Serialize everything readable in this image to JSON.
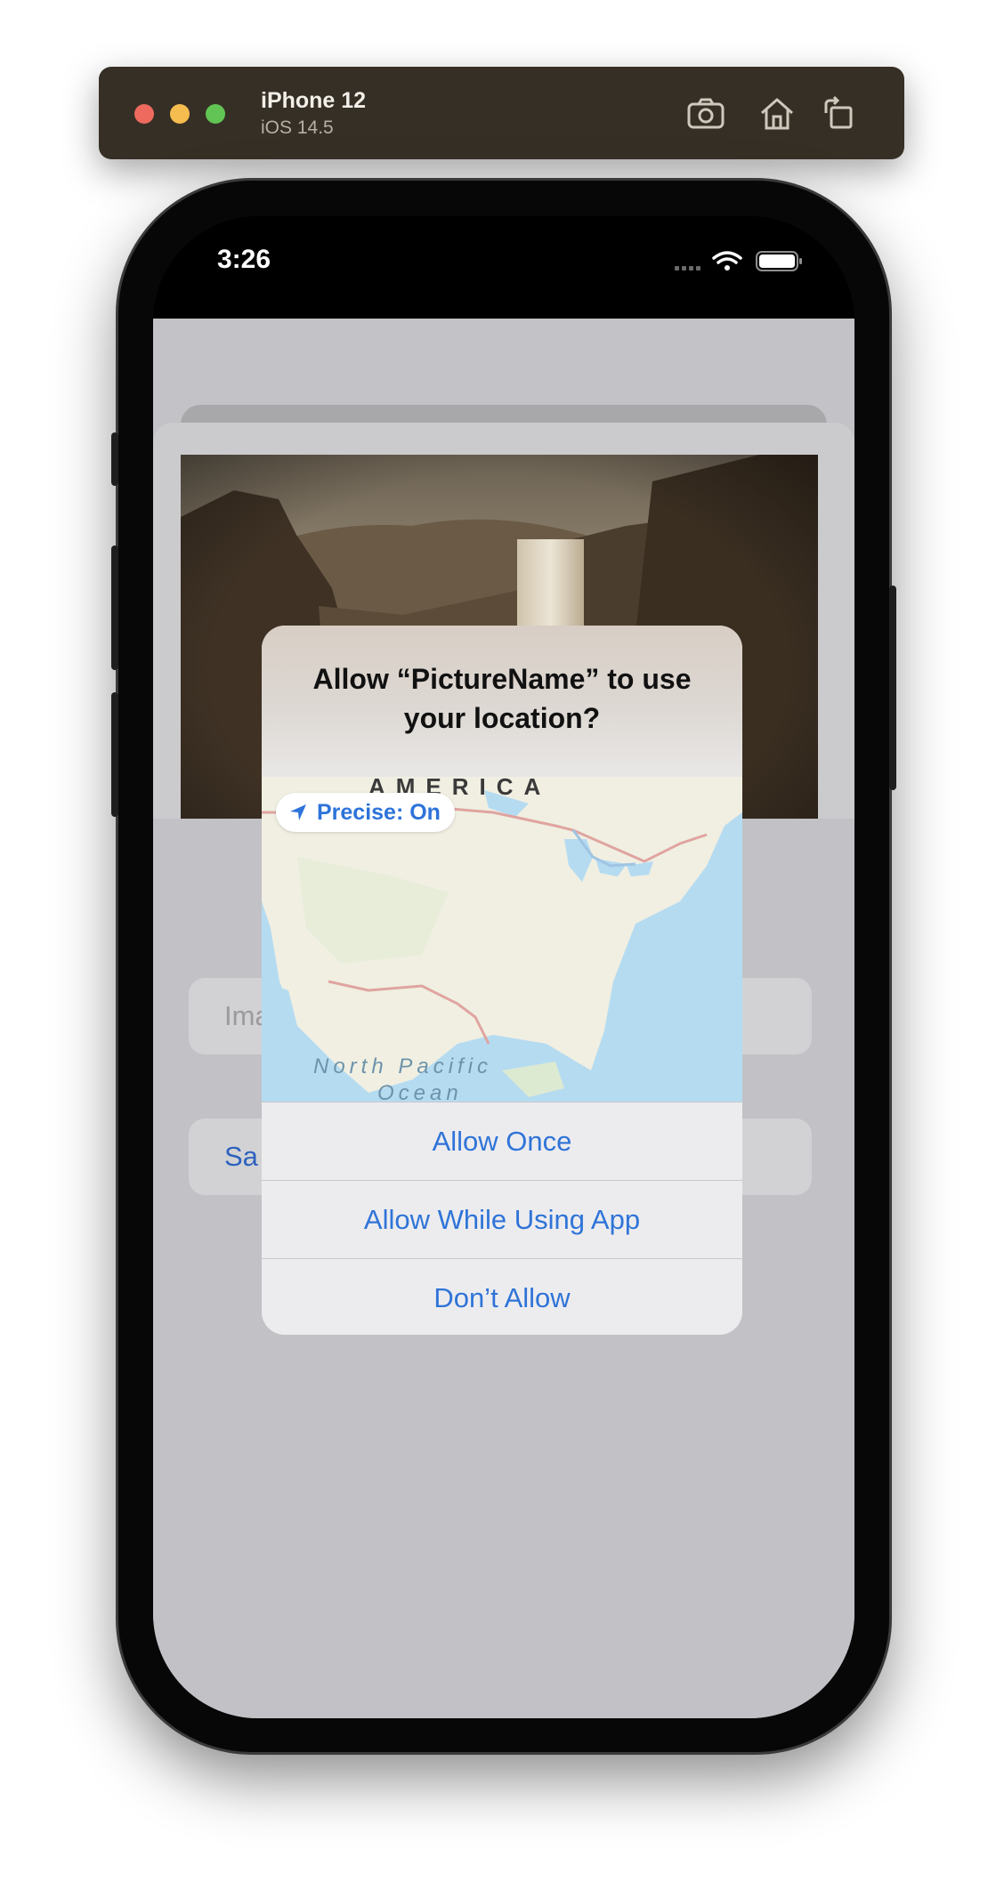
{
  "window": {
    "device_name": "iPhone 12",
    "os_version": "iOS 14.5",
    "toolbar_icons": [
      "screenshot-icon",
      "home-icon",
      "rotate-icon"
    ]
  },
  "status_bar": {
    "time": "3:26",
    "icons": [
      "cellular-icon",
      "wifi-icon",
      "battery-icon"
    ]
  },
  "app": {
    "name_field_text": "Ima",
    "save_button_text": "Sa"
  },
  "alert": {
    "title": "Allow “PictureName” to use your location?",
    "precise_label": "Precise: On",
    "map_region_label": "AMERICA",
    "map_ocean_line1": "North Pacific",
    "map_ocean_line2": "Ocean",
    "buttons": {
      "allow_once": "Allow Once",
      "allow_while_using": "Allow While Using App",
      "dont_allow": "Don’t Allow"
    }
  },
  "colors": {
    "accent_blue": "#2f74d8",
    "toolbar_bg": "#362f25"
  }
}
